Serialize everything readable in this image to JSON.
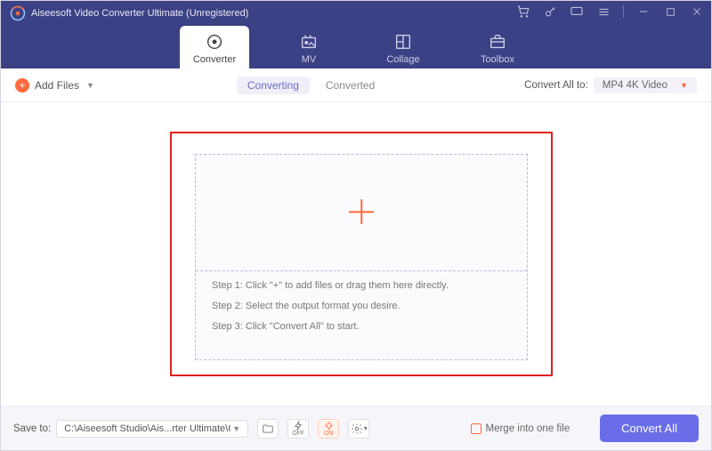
{
  "titlebar": {
    "appTitle": "Aiseesoft Video Converter Ultimate (Unregistered)"
  },
  "tabs": {
    "converter": "Converter",
    "mv": "MV",
    "collage": "Collage",
    "toolbox": "Toolbox"
  },
  "toolbar": {
    "addFiles": "Add Files",
    "converting": "Converting",
    "converted": "Converted",
    "convertAllTo": "Convert All to:",
    "formatSelected": "MP4 4K Video"
  },
  "dropzone": {
    "step1": "Step 1: Click \"+\" to add files or drag them here directly.",
    "step2": "Step 2: Select the output format you desire.",
    "step3": "Step 3: Click \"Convert All\" to start."
  },
  "bottombar": {
    "saveTo": "Save to:",
    "path": "C:\\Aiseesoft Studio\\Ais...rter Ultimate\\Converted",
    "merge": "Merge into one file",
    "convertAll": "Convert All",
    "hwOff": "OFF",
    "hwOn": "ON"
  }
}
